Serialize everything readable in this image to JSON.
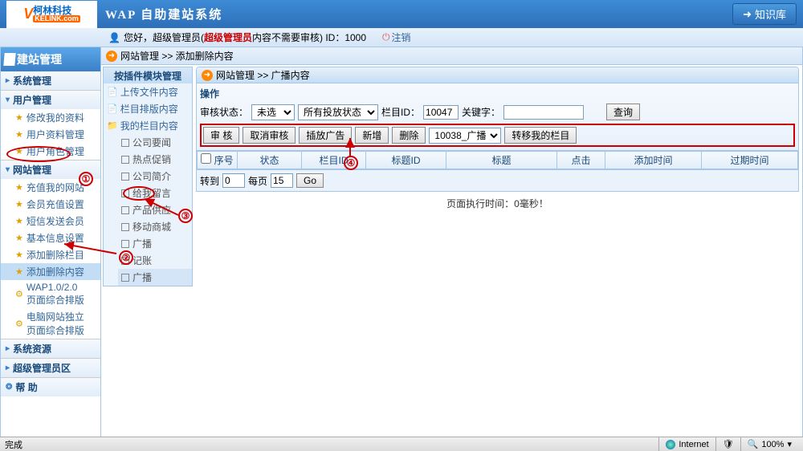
{
  "logo": {
    "brand_cn": "柯林科技",
    "brand_en": "KELINK.com"
  },
  "header": {
    "title": "WAP 自助建站系统",
    "kb_button": "知识库"
  },
  "userbar": {
    "greeting": "您好，超级管理员(",
    "role": "超级管理员",
    "audit": "  内容不需要审核",
    "id_label": ") ID：1000",
    "logout": "注销"
  },
  "nav": {
    "header": "建站管理",
    "cats": {
      "sys": "系统管理",
      "user": "用户管理",
      "site": "网站管理",
      "res": "系统资源",
      "admin": "超级管理员区"
    },
    "user_items": [
      "修改我的资料",
      "用户资料管理",
      "用户角色管理"
    ],
    "site_items": [
      "充值我的网站",
      "会员充值设置",
      "短信发送会员",
      "基本信息设置",
      "添加删除栏目",
      "添加删除内容",
      "WAP1.0/2.0\n页面综合排版",
      "电脑网站独立\n页面综合排版"
    ],
    "help": "帮 助"
  },
  "breadcrumb": {
    "path": "网站管理 >> 添加删除内容"
  },
  "tree": {
    "header": "按插件模块管理",
    "items": [
      "上传文件内容",
      "栏目排版内容",
      "我的栏目内容"
    ],
    "subs": [
      "公司要闻",
      "热点促销",
      "公司简介",
      "给我留言",
      "产品供应",
      "移动商城",
      "广播",
      "记账",
      "广播"
    ]
  },
  "panel": {
    "head": "网站管理 >> 广播内容",
    "op_title": "操作",
    "filter": {
      "status_label": "审核状态：",
      "status_sel": "未选",
      "putstatus_sel": "所有投放状态",
      "col_label": "栏目ID：",
      "col_val": "10047",
      "kw_label": "关键字：",
      "query": "查询"
    },
    "actions": {
      "audit": "审 核",
      "unaudit": "取消审核",
      "putad": "插放广告",
      "add": "新增",
      "del": "删除",
      "sel": "10038_广播",
      "move": "转移我的栏目"
    },
    "table_headers": [
      "序号",
      "状态",
      "栏目ID",
      "标题ID",
      "标题",
      "点击",
      "添加时间",
      "过期时间"
    ],
    "pager": {
      "goto": "转到",
      "goto_val": "0",
      "perpage": "每页",
      "perpage_val": "15",
      "go": "Go"
    },
    "exec": "页面执行时间：0毫秒！"
  },
  "status": {
    "done": "完成",
    "net": "Internet",
    "zoom": "100%"
  },
  "annotations": {
    "n1": "①",
    "n2": "②",
    "n3": "③",
    "n4": "④"
  }
}
